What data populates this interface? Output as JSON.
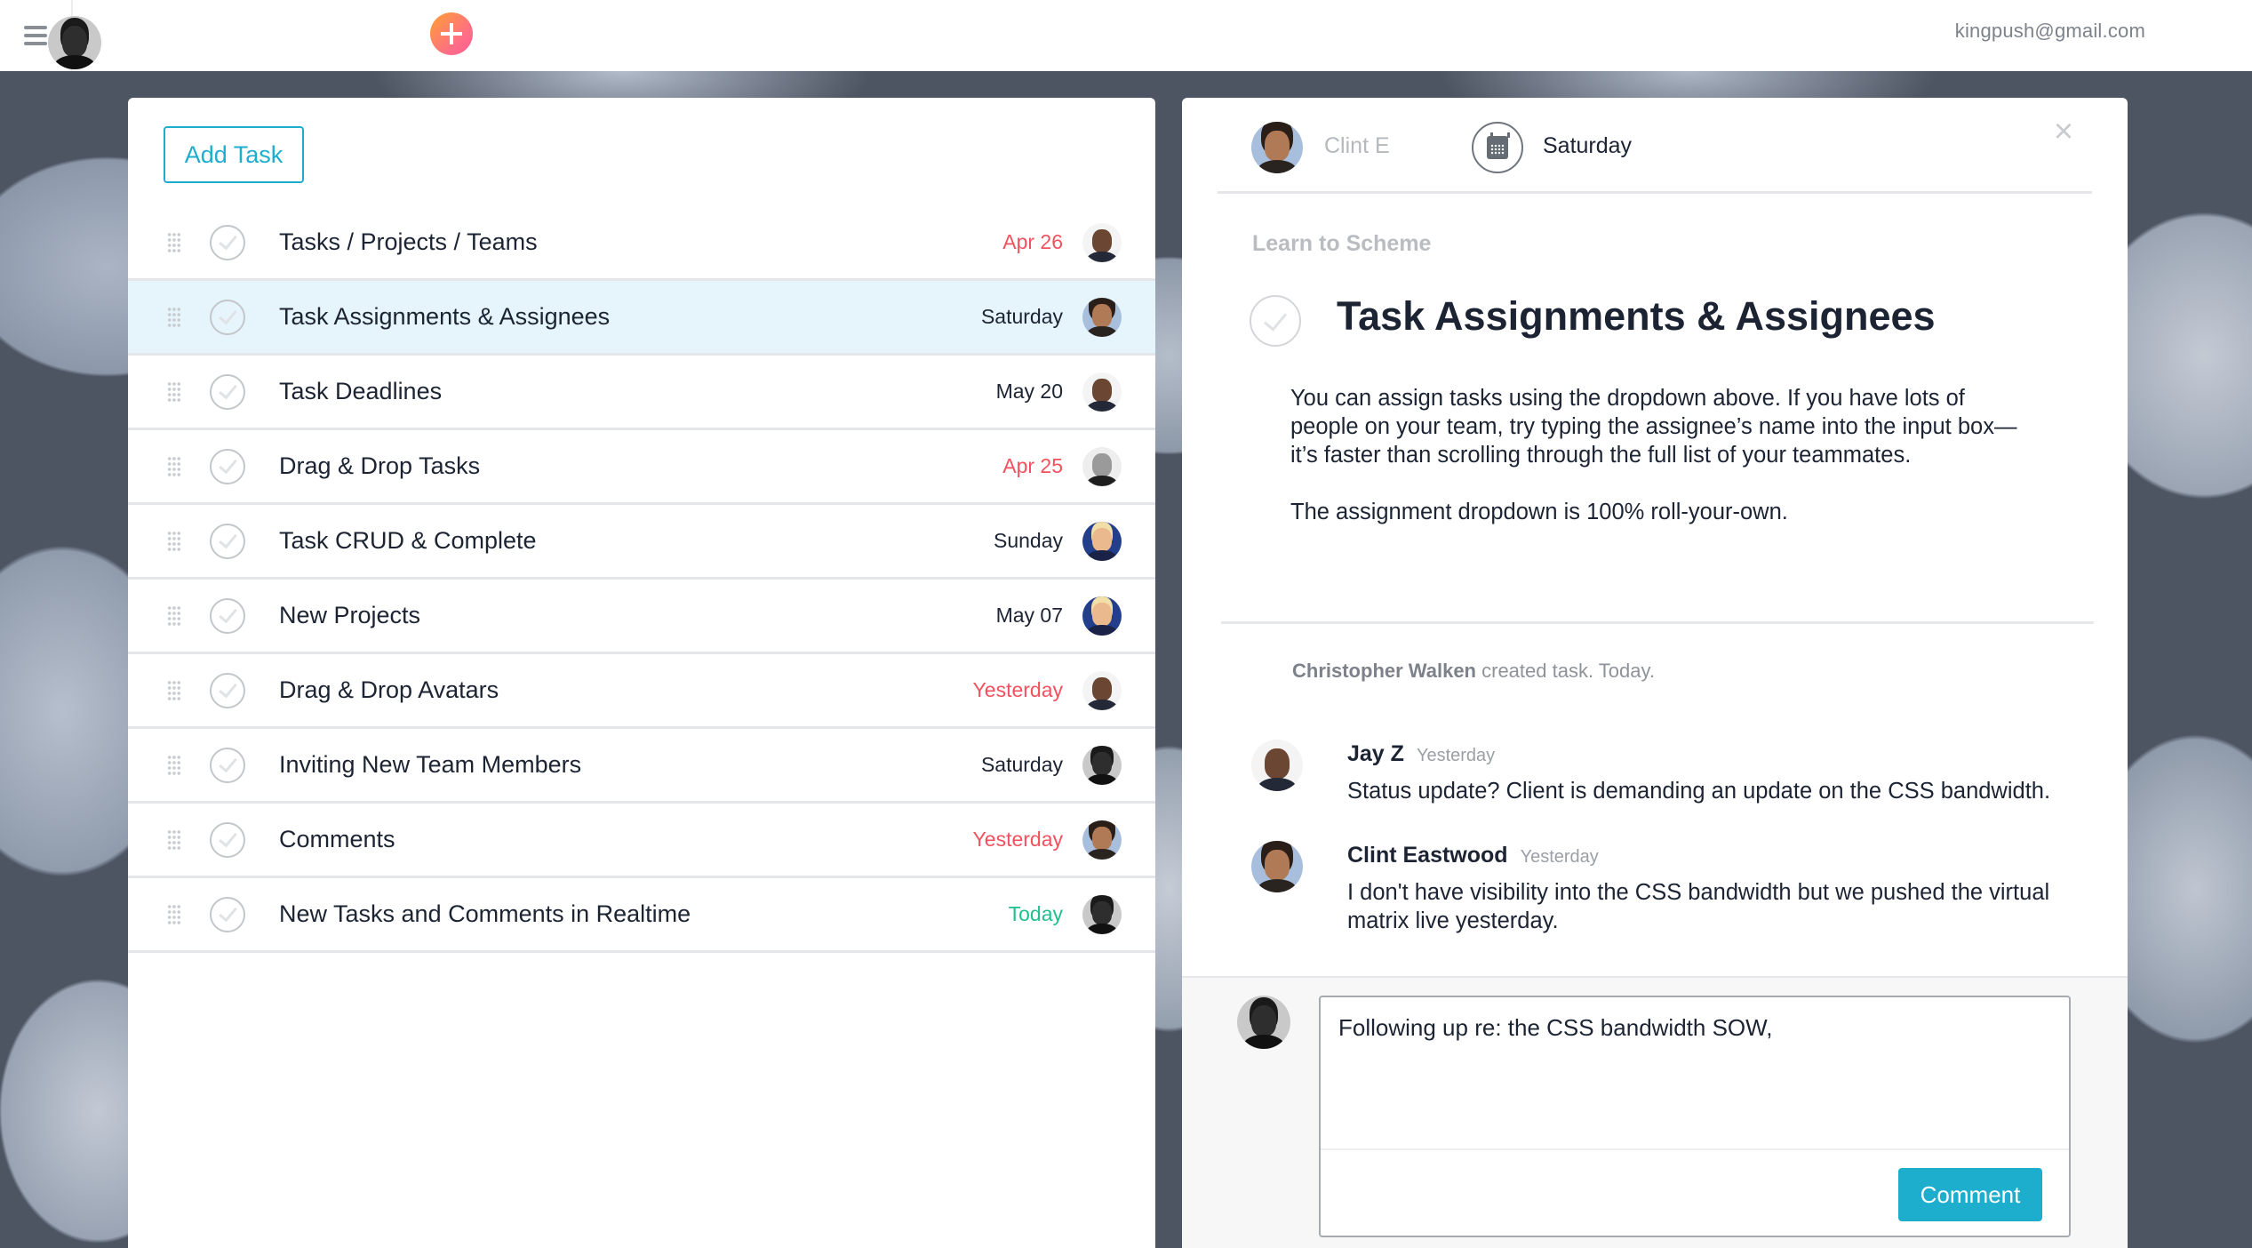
{
  "topbar": {
    "menu_icon": "hamburger-menu-icon",
    "add_icon": "plus-icon",
    "user_email": "kingpush@gmail.com"
  },
  "task_panel": {
    "add_task_label": "Add Task",
    "tasks": [
      {
        "title": "Tasks / Projects / Teams",
        "date": "Apr 26",
        "date_status": "overdue",
        "assignee": "jay",
        "selected": false
      },
      {
        "title": "Task Assignments & Assignees",
        "date": "Saturday",
        "date_status": "normal",
        "assignee": "clint",
        "selected": true
      },
      {
        "title": "Task Deadlines",
        "date": "May 20",
        "date_status": "normal",
        "assignee": "jay",
        "selected": false
      },
      {
        "title": "Drag & Drop Tasks",
        "date": "Apr 25",
        "date_status": "overdue",
        "assignee": "walken",
        "selected": false
      },
      {
        "title": "Task CRUD & Complete",
        "date": "Sunday",
        "date_status": "normal",
        "assignee": "trump",
        "selected": false
      },
      {
        "title": "New Projects",
        "date": "May 07",
        "date_status": "normal",
        "assignee": "trump",
        "selected": false
      },
      {
        "title": "Drag & Drop Avatars",
        "date": "Yesterday",
        "date_status": "overdue",
        "assignee": "jay",
        "selected": false
      },
      {
        "title": "Inviting New Team Members",
        "date": "Saturday",
        "date_status": "normal",
        "assignee": "push",
        "selected": false
      },
      {
        "title": "Comments",
        "date": "Yesterday",
        "date_status": "overdue",
        "assignee": "clint",
        "selected": false
      },
      {
        "title": "New Tasks and Comments in Realtime",
        "date": "Today",
        "date_status": "today",
        "assignee": "push",
        "selected": false
      }
    ]
  },
  "detail": {
    "assignee_name": "Clint E",
    "due_label": "Saturday",
    "close_icon": "close-icon",
    "project": "Learn to Scheme",
    "title": "Task Assignments & Assignees",
    "description": [
      "You can assign tasks using the dropdown above. If you have lots of people on your team, try typing the assignee’s name into the input box—it’s faster than scrolling through the full list of your teammates.",
      "The assignment dropdown is 100% roll-your-own."
    ],
    "activity": {
      "actor": "Christopher Walken",
      "text": " created task. Today."
    },
    "comments": [
      {
        "author": "Jay Z",
        "time": "Yesterday",
        "body": "Status update? Client is demanding an update on the CSS bandwidth.",
        "avatar": "jay"
      },
      {
        "author": "Clint Eastwood",
        "time": "Yesterday",
        "body": "I don't have visibility into the CSS bandwidth but we pushed the virtual matrix live yesterday.",
        "avatar": "clint"
      }
    ],
    "composer": {
      "value": "Following up re: the CSS bandwidth SOW,",
      "button_label": "Comment"
    }
  },
  "colors": {
    "accent": "#1eaecd",
    "overdue": "#f4515f",
    "today": "#1fc08f",
    "selected_row": "#e6f5fb"
  }
}
